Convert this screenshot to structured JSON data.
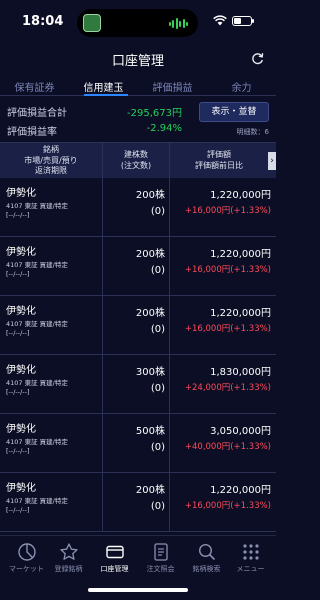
{
  "status": {
    "time": "18:04"
  },
  "header": {
    "title": "口座管理"
  },
  "tabs": [
    {
      "label": "保有証券"
    },
    {
      "label": "信用建玉"
    },
    {
      "label": "評価損益"
    },
    {
      "label": "余力"
    }
  ],
  "summary": {
    "pl_total_label": "評価損益合計",
    "pl_total_value": "-295,673円",
    "pl_rate_label": "評価損益率",
    "pl_rate_value": "-2.94%",
    "display_button": "表示・並替",
    "detail_count": "明細数：6"
  },
  "table": {
    "headers": {
      "col1_line1": "銘柄",
      "col1_line2": "市場/売買/預り",
      "col1_line3": "返済期限",
      "col2_line1": "建株数",
      "col2_line2": "(注文数)",
      "col3_line1": "評価額",
      "col3_line2": "評価額前日比"
    },
    "rows": [
      {
        "name": "伊勢化",
        "market": "4107 東証 買建/特定",
        "limit": "[--/--/--]",
        "qty": "200株",
        "order": "(0)",
        "value": "1,220,000円",
        "change": "+16,000円(+1.33%)"
      },
      {
        "name": "伊勢化",
        "market": "4107 東証 買建/特定",
        "limit": "[--/--/--]",
        "qty": "200株",
        "order": "(0)",
        "value": "1,220,000円",
        "change": "+16,000円(+1.33%)"
      },
      {
        "name": "伊勢化",
        "market": "4107 東証 買建/特定",
        "limit": "[--/--/--]",
        "qty": "200株",
        "order": "(0)",
        "value": "1,220,000円",
        "change": "+16,000円(+1.33%)"
      },
      {
        "name": "伊勢化",
        "market": "4107 東証 買建/特定",
        "limit": "[--/--/--]",
        "qty": "300株",
        "order": "(0)",
        "value": "1,830,000円",
        "change": "+24,000円(+1.33%)"
      },
      {
        "name": "伊勢化",
        "market": "4107 東証 買建/特定",
        "limit": "[--/--/--]",
        "qty": "500株",
        "order": "(0)",
        "value": "3,050,000円",
        "change": "+40,000円(+1.33%)"
      },
      {
        "name": "伊勢化",
        "market": "4107 東証 買建/特定",
        "limit": "[--/--/--]",
        "qty": "200株",
        "order": "(0)",
        "value": "1,220,000円",
        "change": "+16,000円(+1.33%)"
      }
    ]
  },
  "nav": [
    {
      "label": "マーケット",
      "icon": "market-icon"
    },
    {
      "label": "登録銘柄",
      "icon": "star-icon"
    },
    {
      "label": "口座管理",
      "icon": "wallet-icon"
    },
    {
      "label": "注文照会",
      "icon": "document-icon"
    },
    {
      "label": "銘柄検索",
      "icon": "search-icon"
    },
    {
      "label": "メニュー",
      "icon": "grid-menu-icon"
    }
  ],
  "colors": {
    "background": "#0b0e24",
    "accent": "#2e86ff",
    "positive": "#ff4a5a",
    "negative_green": "#23d158"
  }
}
